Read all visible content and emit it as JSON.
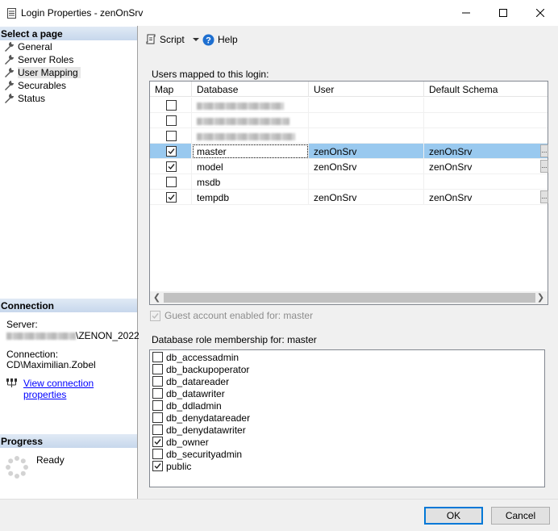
{
  "window": {
    "title": "Login Properties - zenOnSrv",
    "minimize": "—",
    "maximize": "☐",
    "close": "✕"
  },
  "left": {
    "select_page_header": "Select a page",
    "pages": [
      {
        "label": "General"
      },
      {
        "label": "Server Roles"
      },
      {
        "label": "User Mapping"
      },
      {
        "label": "Securables"
      },
      {
        "label": "Status"
      }
    ],
    "connection_header": "Connection",
    "server_label": "Server:",
    "server_value": "\\ZENON_2022",
    "connection_label": "Connection:",
    "connection_value": "CD\\Maximilian.Zobel",
    "view_connection_link": "View connection properties",
    "progress_header": "Progress",
    "progress_status": "Ready"
  },
  "toolbar": {
    "script_label": "Script",
    "help_label": "Help"
  },
  "users_mapped_label": "Users mapped to this login:",
  "grid": {
    "columns": [
      "Map",
      "Database",
      "User",
      "Default Schema"
    ],
    "rows": [
      {
        "map": false,
        "database": "",
        "user": "",
        "schema": "",
        "blurred": true
      },
      {
        "map": false,
        "database": "",
        "user": "",
        "schema": "",
        "blurred": true
      },
      {
        "map": false,
        "database": "",
        "user": "",
        "schema": "",
        "blurred": true
      },
      {
        "map": true,
        "database": "master",
        "user": "zenOnSrv",
        "schema": "zenOnSrv",
        "selected": true
      },
      {
        "map": true,
        "database": "model",
        "user": "zenOnSrv",
        "schema": "zenOnSrv"
      },
      {
        "map": false,
        "database": "msdb",
        "user": "",
        "schema": ""
      },
      {
        "map": true,
        "database": "tempdb",
        "user": "zenOnSrv",
        "schema": "zenOnSrv"
      }
    ]
  },
  "guest_label": "Guest account enabled for: master",
  "role_membership_label": "Database role membership for: master",
  "roles": [
    {
      "name": "db_accessadmin",
      "checked": false
    },
    {
      "name": "db_backupoperator",
      "checked": false
    },
    {
      "name": "db_datareader",
      "checked": false
    },
    {
      "name": "db_datawriter",
      "checked": false
    },
    {
      "name": "db_ddladmin",
      "checked": false
    },
    {
      "name": "db_denydatareader",
      "checked": false
    },
    {
      "name": "db_denydatawriter",
      "checked": false
    },
    {
      "name": "db_owner",
      "checked": true
    },
    {
      "name": "db_securityadmin",
      "checked": false
    },
    {
      "name": "public",
      "checked": true
    }
  ],
  "buttons": {
    "ok": "OK",
    "cancel": "Cancel"
  }
}
